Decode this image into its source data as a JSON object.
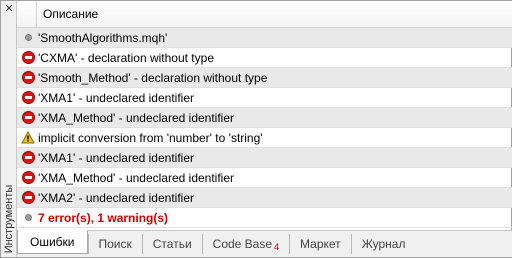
{
  "side_panel": {
    "close_label": "✕",
    "label": "Инструменты"
  },
  "list": {
    "header_title": "Описание",
    "rows": [
      {
        "icon": "info-dot-icon",
        "text": "'SmoothAlgorithms.mqh'"
      },
      {
        "icon": "error-icon",
        "text": "'CXMA' - declaration without type"
      },
      {
        "icon": "error-icon",
        "text": "'Smooth_Method' - declaration without type"
      },
      {
        "icon": "error-icon",
        "text": "'XMA1' - undeclared identifier"
      },
      {
        "icon": "error-icon",
        "text": "'XMA_Method' - undeclared identifier"
      },
      {
        "icon": "warning-icon",
        "text": "implicit conversion from 'number' to 'string'"
      },
      {
        "icon": "error-icon",
        "text": "'XMA1' - undeclared identifier"
      },
      {
        "icon": "error-icon",
        "text": "'XMA_Method' - undeclared identifier"
      },
      {
        "icon": "error-icon",
        "text": "'XMA2' - undeclared identifier"
      }
    ],
    "summary": {
      "icon": "info-dot-icon",
      "text": "7 error(s), 1 warning(s)"
    }
  },
  "tabs": [
    {
      "label": "Ошибки",
      "active": true
    },
    {
      "label": "Поиск"
    },
    {
      "label": "Статьи"
    },
    {
      "label": "Code Base",
      "badge": "4"
    },
    {
      "label": "Маркет"
    },
    {
      "label": "Журнал"
    }
  ],
  "colors": {
    "error": "#d41818",
    "summary_text": "#d00000",
    "warning": "#f0c020"
  }
}
